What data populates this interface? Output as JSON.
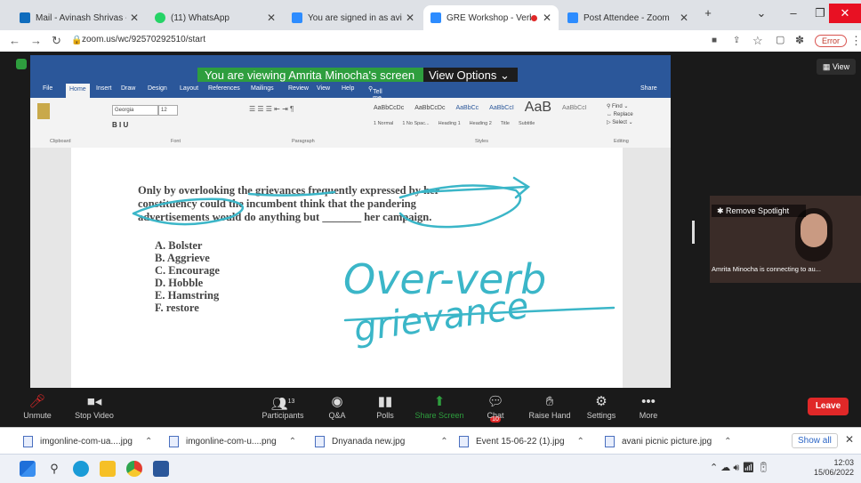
{
  "browser": {
    "tabs": [
      {
        "title": "Mail - Avinash Shrivas - Outl",
        "favicon_color": "#0f6cbd",
        "active": false
      },
      {
        "title": "(11) WhatsApp",
        "favicon_color": "#25d366",
        "active": false
      },
      {
        "title": "You are signed in as avinash",
        "favicon_color": "#2d8cff",
        "active": false
      },
      {
        "title": "GRE Workshop - Verbal",
        "favicon_color": "#2d8cff",
        "active": true
      },
      {
        "title": "Post Attendee - Zoom",
        "favicon_color": "#2d8cff",
        "active": false
      }
    ],
    "url": "zoom.us/wc/92570292510/start",
    "profile_label": "Error"
  },
  "zoom": {
    "banner_text": "You are viewing Amrita Minocha's screen",
    "view_options_label": "View Options",
    "view_button_label": "View",
    "remove_spotlight_label": "Remove Spotlight",
    "participant_caption": "Amrita Minocha is connecting to au...",
    "toolbar": [
      {
        "label": "Unmute",
        "icon": "mic-muted-icon"
      },
      {
        "label": "Stop Video",
        "icon": "video-icon"
      },
      {
        "label": "Participants",
        "icon": "participants-icon",
        "badge": "13"
      },
      {
        "label": "Q&A",
        "icon": "qa-icon"
      },
      {
        "label": "Polls",
        "icon": "polls-icon"
      },
      {
        "label": "Share Screen",
        "icon": "share-screen-icon"
      },
      {
        "label": "Chat",
        "icon": "chat-icon",
        "badge": "10"
      },
      {
        "label": "Raise Hand",
        "icon": "raise-hand-icon"
      },
      {
        "label": "Settings",
        "icon": "settings-icon"
      },
      {
        "label": "More",
        "icon": "more-icon"
      }
    ],
    "leave_label": "Leave"
  },
  "word": {
    "ribbon_tabs": [
      "File",
      "Home",
      "Insert",
      "Draw",
      "Design",
      "Layout",
      "References",
      "Mailings",
      "Review",
      "View",
      "Help"
    ],
    "tell_me": "Tell me what you want to do",
    "share_label": "Share",
    "font_name": "Georgia",
    "font_size": "12",
    "styles": [
      "1 Normal",
      "1 No Spac...",
      "Heading 1",
      "Heading 2",
      "Title",
      "Subtitle"
    ],
    "groups": [
      "Clipboard",
      "Font",
      "Paragraph",
      "Styles",
      "Editing"
    ],
    "question_lines": [
      "Only by overlooking the grievances frequently expressed by her",
      "constituency could the incumbent think that the pandering",
      "advertisements would do anything but _______ her campaign."
    ],
    "options": [
      "A. Bolster",
      "B. Aggrieve",
      "C. Encourage",
      "D. Hobble",
      "E. Hamstring",
      "F. restore"
    ],
    "annotations": [
      "Over-verb",
      "grievance"
    ]
  },
  "downloads": [
    {
      "name": "imgonline-com-ua....jpg"
    },
    {
      "name": "imgonline-com-u....png"
    },
    {
      "name": "Dnyanada new.jpg"
    },
    {
      "name": "Event 15-06-22 (1).jpg"
    },
    {
      "name": "avani picnic picture.jpg"
    }
  ],
  "downloads_show_all": "Show all",
  "taskbar": {
    "time": "12:03",
    "date": "15/06/2022"
  },
  "colors": {
    "zoom_green": "#2e9e3e",
    "word_blue": "#2b579a",
    "annotation": "#3bb6c8",
    "leave_red": "#e02828"
  }
}
